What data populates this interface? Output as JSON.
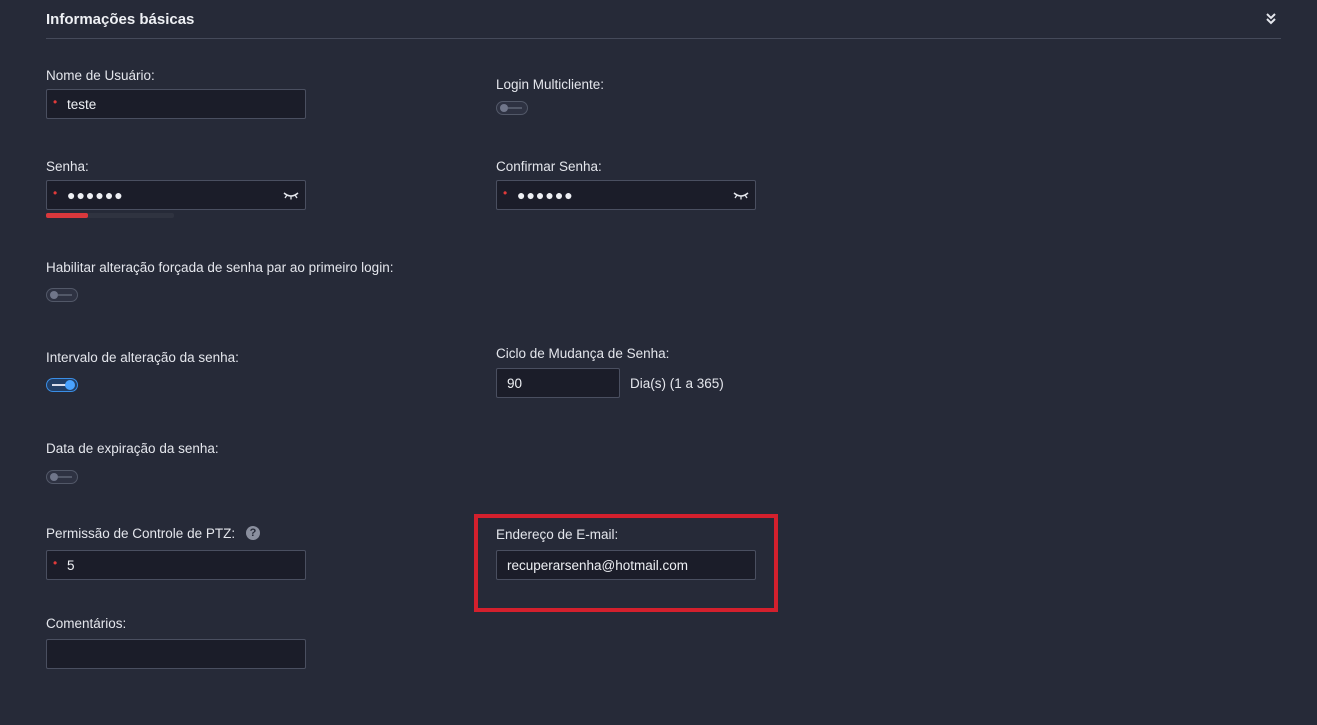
{
  "section": {
    "title": "Informações básicas",
    "collapse_icon": "double-chevron-down-icon"
  },
  "fields": {
    "username": {
      "label": "Nome de Usuário:",
      "value": "teste",
      "required": true
    },
    "multiclient_login": {
      "label": "Login Multicliente:",
      "enabled": false
    },
    "password": {
      "label": "Senha:",
      "masked_value": "●●●●●●",
      "required": true,
      "strength": 0.33,
      "strength_color": "#d9383c"
    },
    "confirm_password": {
      "label": "Confirmar Senha:",
      "masked_value": "●●●●●●",
      "required": true
    },
    "force_change": {
      "label": "Habilitar alteração forçada de senha par ao primeiro login:",
      "enabled": false
    },
    "change_interval": {
      "label": "Intervalo de alteração da senha:",
      "enabled": true
    },
    "change_cycle": {
      "label": "Ciclo de Mudança de Senha:",
      "value": "90",
      "suffix": "Dia(s) (1 a 365)"
    },
    "expiration_date": {
      "label": "Data de expiração da senha:",
      "enabled": false
    },
    "ptz_permission": {
      "label": "Permissão de Controle de PTZ:",
      "value": "5",
      "required": true,
      "help_icon": "?"
    },
    "email": {
      "label": "Endereço de E-mail:",
      "value": "recuperarsenha@hotmail.com"
    },
    "comments": {
      "label": "Comentários:",
      "value": ""
    }
  },
  "colors": {
    "background": "#262a38",
    "input_bg": "#1b1d29",
    "required": "#e03a3a",
    "toggle_on": "#4aa3ff",
    "highlight": "#d3202d"
  }
}
